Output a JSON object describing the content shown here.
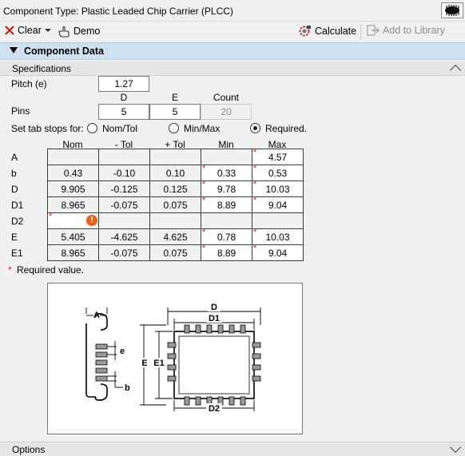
{
  "title": "Component Type: Plastic Leaded Chip Carrier (PLCC)",
  "toolbar": {
    "clear": "Clear",
    "demo": "Demo",
    "calculate": "Calculate",
    "add_to_library": "Add to Library"
  },
  "section_title": "Component Data",
  "specifications_label": "Specifications",
  "pitch": {
    "label": "Pitch (e)",
    "value": "1.27"
  },
  "pins": {
    "label": "Pins",
    "col_d": "D",
    "col_e": "E",
    "col_count": "Count",
    "d_value": "5",
    "e_value": "5",
    "count_value": "20"
  },
  "tabstops": {
    "label": "Set tab stops for:",
    "options": [
      "Nom/Tol",
      "Min/Max",
      "Required."
    ],
    "selected": "Required."
  },
  "table": {
    "columns": [
      "Nom",
      "- Tol",
      "+ Tol",
      "Min",
      "Max"
    ],
    "rows": [
      {
        "label": "A",
        "nom": "",
        "mtol": "",
        "ptol": "",
        "min": "",
        "max": "4.57"
      },
      {
        "label": "b",
        "nom": "0.43",
        "mtol": "-0.10",
        "ptol": "0.10",
        "min": "0.33",
        "max": "0.53"
      },
      {
        "label": "D",
        "nom": "9.905",
        "mtol": "-0.125",
        "ptol": "0.125",
        "min": "9.78",
        "max": "10.03"
      },
      {
        "label": "D1",
        "nom": "8.965",
        "mtol": "-0.075",
        "ptol": "0.075",
        "min": "8.89",
        "max": "9.04"
      },
      {
        "label": "D2",
        "nom": "",
        "mtol": "",
        "ptol": "",
        "min": "",
        "max": ""
      },
      {
        "label": "E",
        "nom": "5.405",
        "mtol": "-4.625",
        "ptol": "4.625",
        "min": "0.78",
        "max": "10.03"
      },
      {
        "label": "E1",
        "nom": "8.965",
        "mtol": "-0.075",
        "ptol": "0.075",
        "min": "8.89",
        "max": "9.04"
      }
    ]
  },
  "required_note": "Required value.",
  "required_mark": "*",
  "error_mark": "!",
  "figure_labels": {
    "a": "A",
    "d": "D",
    "d1": "D1",
    "d2": "D2",
    "e": "E",
    "e1": "E1",
    "pitch": "e",
    "b": "b"
  },
  "options_label": "Options",
  "colors": {
    "header_bg": "#cfe0f0",
    "required": "#d81b1b",
    "error": "#e8611a"
  }
}
